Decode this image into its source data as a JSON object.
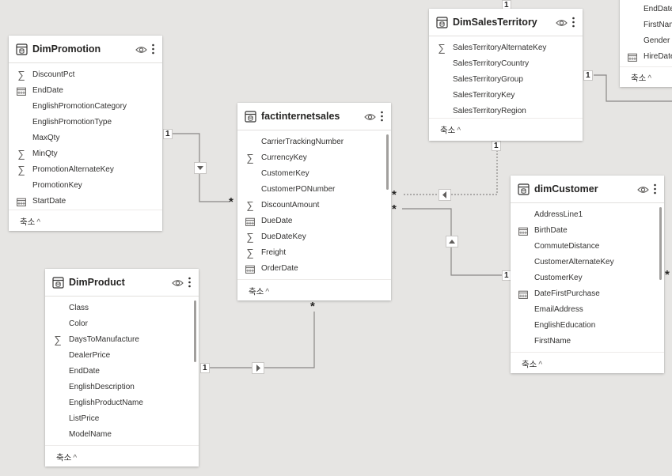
{
  "tables": {
    "dimpromotion": {
      "title": "DimPromotion",
      "collapse_label": "축소",
      "fields": [
        {
          "name": "DiscountPct",
          "icon": "sigma"
        },
        {
          "name": "EndDate",
          "icon": "calendar"
        },
        {
          "name": "EnglishPromotionCategory",
          "icon": ""
        },
        {
          "name": "EnglishPromotionType",
          "icon": ""
        },
        {
          "name": "MaxQty",
          "icon": ""
        },
        {
          "name": "MinQty",
          "icon": "sigma"
        },
        {
          "name": "PromotionAlternateKey",
          "icon": "sigma"
        },
        {
          "name": "PromotionKey",
          "icon": ""
        },
        {
          "name": "StartDate",
          "icon": "calendar"
        }
      ]
    },
    "factinternetsales": {
      "title": "factinternetsales",
      "collapse_label": "축소",
      "fields": [
        {
          "name": "CarrierTrackingNumber",
          "icon": ""
        },
        {
          "name": "CurrencyKey",
          "icon": "sigma"
        },
        {
          "name": "CustomerKey",
          "icon": ""
        },
        {
          "name": "CustomerPONumber",
          "icon": ""
        },
        {
          "name": "DiscountAmount",
          "icon": "sigma"
        },
        {
          "name": "DueDate",
          "icon": "calendar"
        },
        {
          "name": "DueDateKey",
          "icon": "sigma"
        },
        {
          "name": "Freight",
          "icon": "sigma"
        },
        {
          "name": "OrderDate",
          "icon": "calendar"
        }
      ]
    },
    "dimsalesterritory": {
      "title": "DimSalesTerritory",
      "collapse_label": "축소",
      "fields": [
        {
          "name": "SalesTerritoryAlternateKey",
          "icon": "sigma"
        },
        {
          "name": "SalesTerritoryCountry",
          "icon": ""
        },
        {
          "name": "SalesTerritoryGroup",
          "icon": ""
        },
        {
          "name": "SalesTerritoryKey",
          "icon": ""
        },
        {
          "name": "SalesTerritoryRegion",
          "icon": ""
        }
      ]
    },
    "dimcustomer": {
      "title": "dimCustomer",
      "collapse_label": "축소",
      "fields": [
        {
          "name": "AddressLine1",
          "icon": ""
        },
        {
          "name": "BirthDate",
          "icon": "calendar"
        },
        {
          "name": "CommuteDistance",
          "icon": ""
        },
        {
          "name": "CustomerAlternateKey",
          "icon": ""
        },
        {
          "name": "CustomerKey",
          "icon": ""
        },
        {
          "name": "DateFirstPurchase",
          "icon": "calendar"
        },
        {
          "name": "EmailAddress",
          "icon": ""
        },
        {
          "name": "EnglishEducation",
          "icon": ""
        },
        {
          "name": "FirstName",
          "icon": ""
        }
      ]
    },
    "dimproduct": {
      "title": "DimProduct",
      "collapse_label": "축소",
      "fields": [
        {
          "name": "Class",
          "icon": ""
        },
        {
          "name": "Color",
          "icon": ""
        },
        {
          "name": "DaysToManufacture",
          "icon": "sigma"
        },
        {
          "name": "DealerPrice",
          "icon": ""
        },
        {
          "name": "EndDate",
          "icon": ""
        },
        {
          "name": "EnglishDescription",
          "icon": ""
        },
        {
          "name": "EnglishProductName",
          "icon": ""
        },
        {
          "name": "ListPrice",
          "icon": ""
        },
        {
          "name": "ModelName",
          "icon": ""
        }
      ]
    },
    "partial_employee": {
      "collapse_label": "축소",
      "fields": [
        {
          "name": "EndDate",
          "icon": ""
        },
        {
          "name": "FirstName",
          "icon": ""
        },
        {
          "name": "Gender",
          "icon": ""
        },
        {
          "name": "HireDate",
          "icon": "calendar"
        }
      ]
    }
  },
  "relationships": {
    "one_label": "1",
    "many_label": "*"
  },
  "colors": {
    "canvas": "#e6e5e3",
    "card": "#ffffff",
    "line": "#8a8886",
    "accent": "#118dff"
  }
}
